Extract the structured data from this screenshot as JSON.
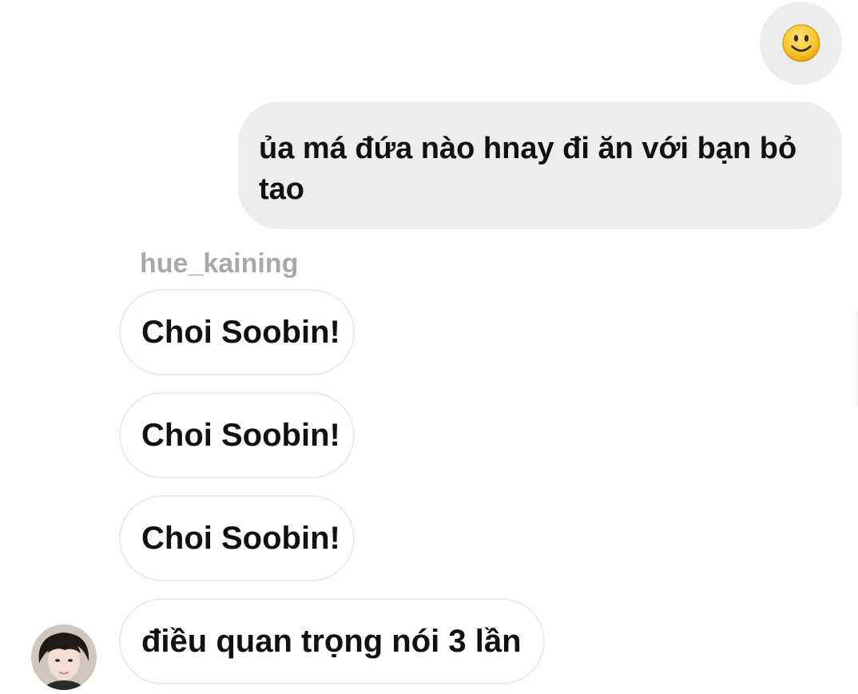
{
  "conversation": {
    "outgoing": [
      {
        "type": "emoji",
        "icon": "slightly-smiling-face-icon",
        "emoji": "🙂"
      },
      {
        "type": "text",
        "text": "ủa má đứa nào hnay đi ăn với bạn bỏ tao"
      }
    ],
    "incoming_sender": "hue_kaining",
    "incoming": [
      {
        "text": "Choi Soobin!"
      },
      {
        "text": "Choi Soobin!"
      },
      {
        "text": "Choi Soobin!"
      },
      {
        "text": "điều quan trọng nói 3 lần"
      }
    ]
  },
  "colors": {
    "outgoing_bubble": "#ededed",
    "incoming_border": "#ececec",
    "sender_name": "#a8a8a8",
    "text": "#111111",
    "emoji_face": "#f7c52b"
  }
}
